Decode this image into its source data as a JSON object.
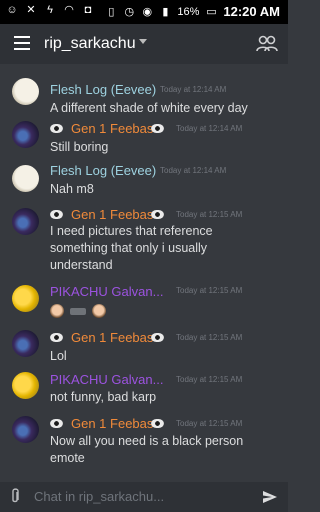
{
  "status_bar": {
    "time": "12:20 AM",
    "battery": "16%"
  },
  "app_bar": {
    "channel": "rip_sarkachu"
  },
  "messages": [
    {
      "author": "Flesh Log (Eevee)",
      "time": "Today at 12:14 AM",
      "lines": [
        "A different shade of white every day"
      ],
      "avatar": "eevee"
    },
    {
      "author": "Gen 1 Feebas",
      "time": "Today at 12:14 AM",
      "lines": [
        "Still boring"
      ],
      "avatar": "feebas"
    },
    {
      "author": "Flesh Log (Eevee)",
      "time": "Today at 12:14 AM",
      "lines": [
        "Nah m8"
      ],
      "avatar": "eevee"
    },
    {
      "author": "Gen 1 Feebas",
      "time": "Today at 12:15 AM",
      "lines": [
        "I need pictures that reference",
        "something that only i usually",
        "understand"
      ],
      "avatar": "feebas"
    },
    {
      "author": "PIKACHU Galvan...",
      "time": "Today at 12:15 AM",
      "lines": [],
      "emotes": [
        "face",
        "gun",
        "face"
      ],
      "avatar": "pika"
    },
    {
      "author": "Gen 1 Feebas",
      "time": "Today at 12:15 AM",
      "lines": [
        "Lol"
      ],
      "avatar": "feebas"
    },
    {
      "author": "PIKACHU Galvan...",
      "time": "Today at 12:15 AM",
      "lines": [
        "not funny, bad karp"
      ],
      "avatar": "pika"
    },
    {
      "author": "Gen 1 Feebas",
      "time": "Today at 12:15 AM",
      "lines": [
        "Now all you need is a black person",
        "emote"
      ],
      "avatar": "feebas"
    }
  ],
  "input": {
    "placeholder": "Chat in rip_sarkachu..."
  },
  "colors": {
    "background": "#36393e",
    "eevee_name": "#9ed2e0",
    "feebas_name": "#f08a3a",
    "pikachu_name": "#9c53e0"
  }
}
